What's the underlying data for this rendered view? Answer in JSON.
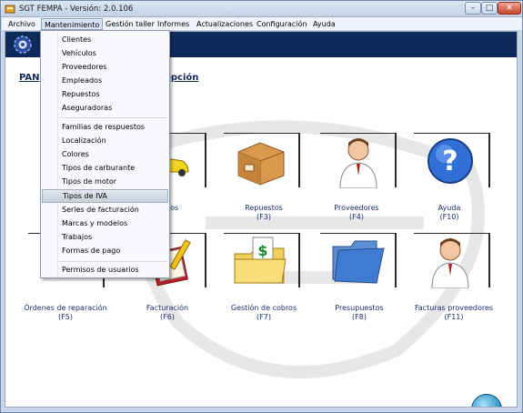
{
  "window": {
    "title": "SGT FEMPA - Versión: 2.0.106"
  },
  "menubar": {
    "items": [
      {
        "label": "Archivo"
      },
      {
        "label": "Mantenimiento"
      },
      {
        "label": "Gestión taller"
      },
      {
        "label": "Informes"
      },
      {
        "label": "Actualizaciones"
      },
      {
        "label": "Configuración"
      },
      {
        "label": "Ayuda"
      }
    ]
  },
  "panel": {
    "title_left": "PAN",
    "title_right": "opción"
  },
  "dropdown": {
    "items": [
      {
        "label": "Clientes"
      },
      {
        "label": "Vehículos"
      },
      {
        "label": "Proveedores"
      },
      {
        "label": "Empleados"
      },
      {
        "label": "Repuestos"
      },
      {
        "label": "Aseguradoras"
      },
      {
        "label": "Familias de respuestos"
      },
      {
        "label": "Localización"
      },
      {
        "label": "Colores"
      },
      {
        "label": "Tipos de carburante"
      },
      {
        "label": "Tipos de motor"
      },
      {
        "label": "Tipos de IVA",
        "highlighted": true
      },
      {
        "label": "Series de facturación"
      },
      {
        "label": "Marcas y modelos"
      },
      {
        "label": "Trabajos"
      },
      {
        "label": "Formas de pago"
      },
      {
        "label": "Permisos de usuarios"
      }
    ]
  },
  "tiles": {
    "row1": [
      {
        "label": "ulos",
        "key": ""
      },
      {
        "label": "Repuestos",
        "key": "(F3)"
      },
      {
        "label": "Proveedores",
        "key": "(F4)"
      },
      {
        "label": "Ayuda",
        "key": "(F10)"
      }
    ],
    "row2": [
      {
        "label": "Órdenes  de  reparación",
        "key": "(F5)"
      },
      {
        "label": "Facturación",
        "key": "(F6)"
      },
      {
        "label": "Gestión de cobros",
        "key": "(F7)"
      },
      {
        "label": "Presupuestos",
        "key": "(F8)"
      },
      {
        "label": "Facturas proveedores",
        "key": "(F11)"
      }
    ]
  },
  "icons": {
    "app": "app-icon",
    "logo": "gear-logo-icon",
    "repuestos": "box-icon",
    "proveedores": "doctor-person-icon",
    "ayuda": "help-question-icon",
    "facturacion": "invoice-pencil-icon",
    "cobros": "money-folder-icon",
    "presupuestos": "blue-folder-icon",
    "facturas_proveedores": "doctor-person-icon",
    "exit": "power-exit-icon"
  },
  "colors": {
    "header_band": "#0e2a5a",
    "label_blue": "#1c2e6e"
  }
}
